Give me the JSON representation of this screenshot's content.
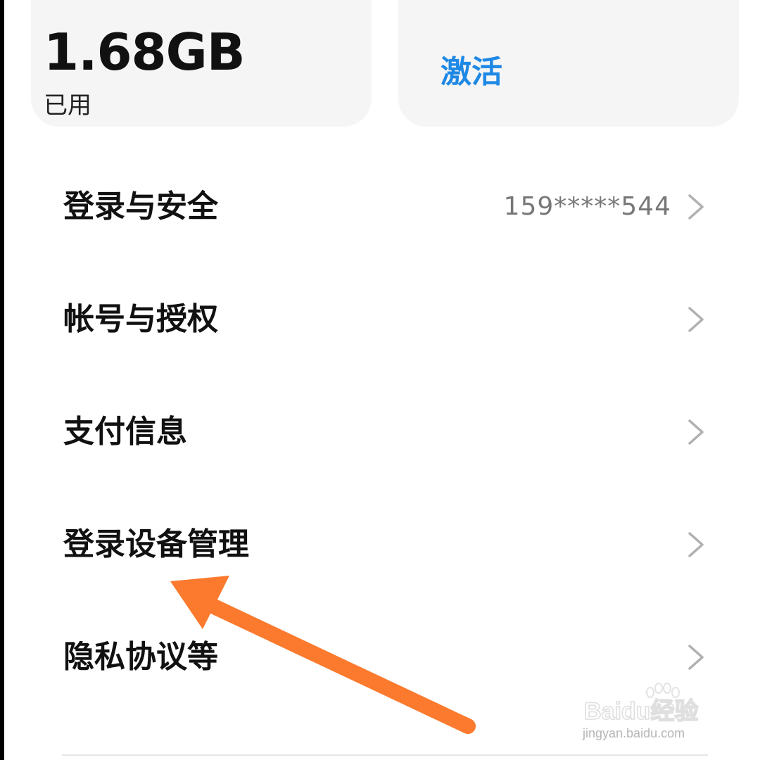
{
  "storage_card": {
    "value": "1.68GB",
    "label": "已用"
  },
  "activate_card": {
    "label": "激活"
  },
  "menu": [
    {
      "label": "登录与安全",
      "value": "159*****544"
    },
    {
      "label": "帐号与授权",
      "value": ""
    },
    {
      "label": "支付信息",
      "value": ""
    },
    {
      "label": "登录设备管理",
      "value": ""
    },
    {
      "label": "隐私协议等",
      "value": ""
    }
  ],
  "watermark": {
    "brand": "Baidu经验",
    "url": "jingyan.baidu.com"
  },
  "colors": {
    "accent_blue": "#1e88e5",
    "arrow_orange": "#fb7a2e",
    "card_bg": "#f5f5f5"
  }
}
